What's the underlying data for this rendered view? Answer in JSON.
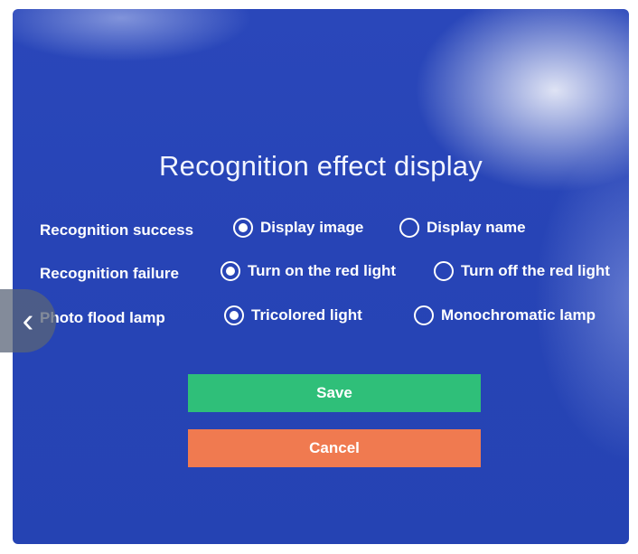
{
  "dialog": {
    "title": "Recognition effect display"
  },
  "settings": [
    {
      "label": "Recognition success",
      "options": [
        {
          "text": "Display image",
          "selected": true
        },
        {
          "text": "Display name",
          "selected": false
        }
      ]
    },
    {
      "label": "Recognition failure",
      "options": [
        {
          "text": "Turn on the red light",
          "selected": true
        },
        {
          "text": "Turn off the red light",
          "selected": false
        }
      ]
    },
    {
      "label": "Photo flood lamp",
      "options": [
        {
          "text": "Tricolored light",
          "selected": true
        },
        {
          "text": "Monochromatic lamp",
          "selected": false
        }
      ]
    }
  ],
  "buttons": {
    "save_label": "Save",
    "cancel_label": "Cancel"
  },
  "nav": {
    "prev_icon": "chevron-left-icon",
    "prev_glyph": "‹"
  },
  "colors": {
    "background": "#2744b6",
    "save": "#2fbf79",
    "cancel": "#f07a50"
  }
}
